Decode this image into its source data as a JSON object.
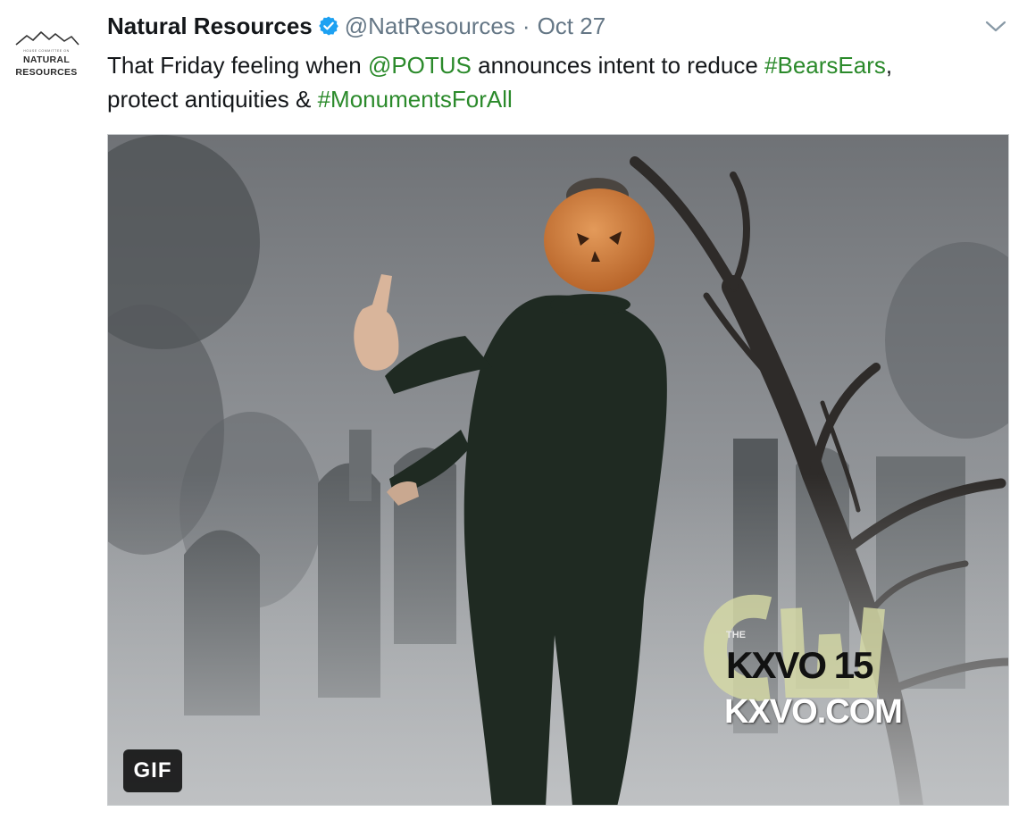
{
  "tweet": {
    "author_name": "Natural Resources",
    "handle": "@NatResources",
    "separator": "·",
    "date": "Oct 27",
    "text_parts": {
      "p1": "That Friday feeling when ",
      "mention": "@POTUS",
      "p2": " announces intent to reduce ",
      "hashtag1": "#BearsEars",
      "p3": ",",
      "p4": "protect antiquities & ",
      "hashtag2": "#MonumentsForAll"
    },
    "link_color": "#2b8a2b"
  },
  "avatar": {
    "small_text": "HOUSE COMMITTEE ON",
    "line1": "NATURAL",
    "line2": "RESOURCES"
  },
  "media": {
    "badge": "GIF",
    "watermark_the": "THE",
    "watermark_station": "KXVO 15",
    "watermark_url": "KXVO.COM"
  },
  "icons": {
    "verified": "verified-badge-icon",
    "caret": "chevron-down-icon"
  }
}
